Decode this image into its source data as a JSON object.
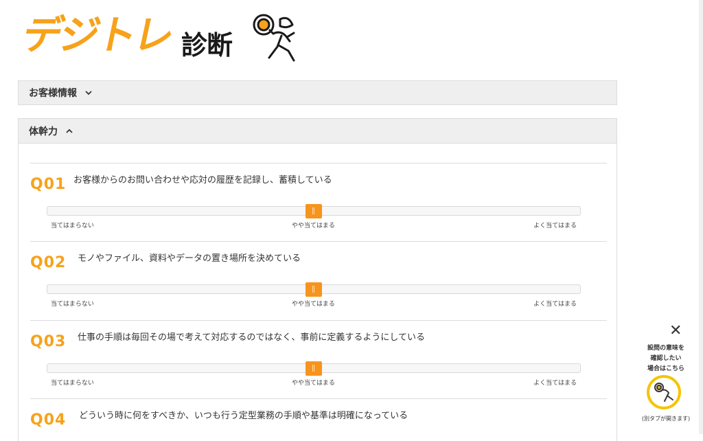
{
  "logo": {
    "brand": "デジトレ",
    "suffix": "診断"
  },
  "sections": {
    "customer": {
      "title": "お客様情報",
      "icon": "chevron-down-icon"
    },
    "core": {
      "title": "体幹力",
      "icon": "chevron-up-icon"
    }
  },
  "scale_labels": {
    "low": "当てはまらない",
    "mid": "やや当てはまる",
    "high": "よく当てはまる"
  },
  "questions": [
    {
      "num": "Q01",
      "text": "お客様からのお問い合わせや応対の履歴を記録し、蓄積している",
      "value": 0.5
    },
    {
      "num": "Q02",
      "text": "モノやファイル、資料やデータの置き場所を決めている",
      "value": 0.5
    },
    {
      "num": "Q03",
      "text": "仕事の手順は毎回その場で考えて対応するのではなく、事前に定義するようにしている",
      "value": 0.5
    },
    {
      "num": "Q04",
      "text": "どういう時に何をすべきか、いつも行う定型業務の手順や基準は明確になっている",
      "value": null
    }
  ],
  "helper": {
    "close_icon": "close-icon",
    "line1": "設問の意味を",
    "line2": "確認したい",
    "line3": "場合はこちら",
    "note": "(別タブが開きます)"
  },
  "colors": {
    "accent": "#f7941d",
    "brand": "#f7a21b",
    "ring": "#f5c400"
  }
}
